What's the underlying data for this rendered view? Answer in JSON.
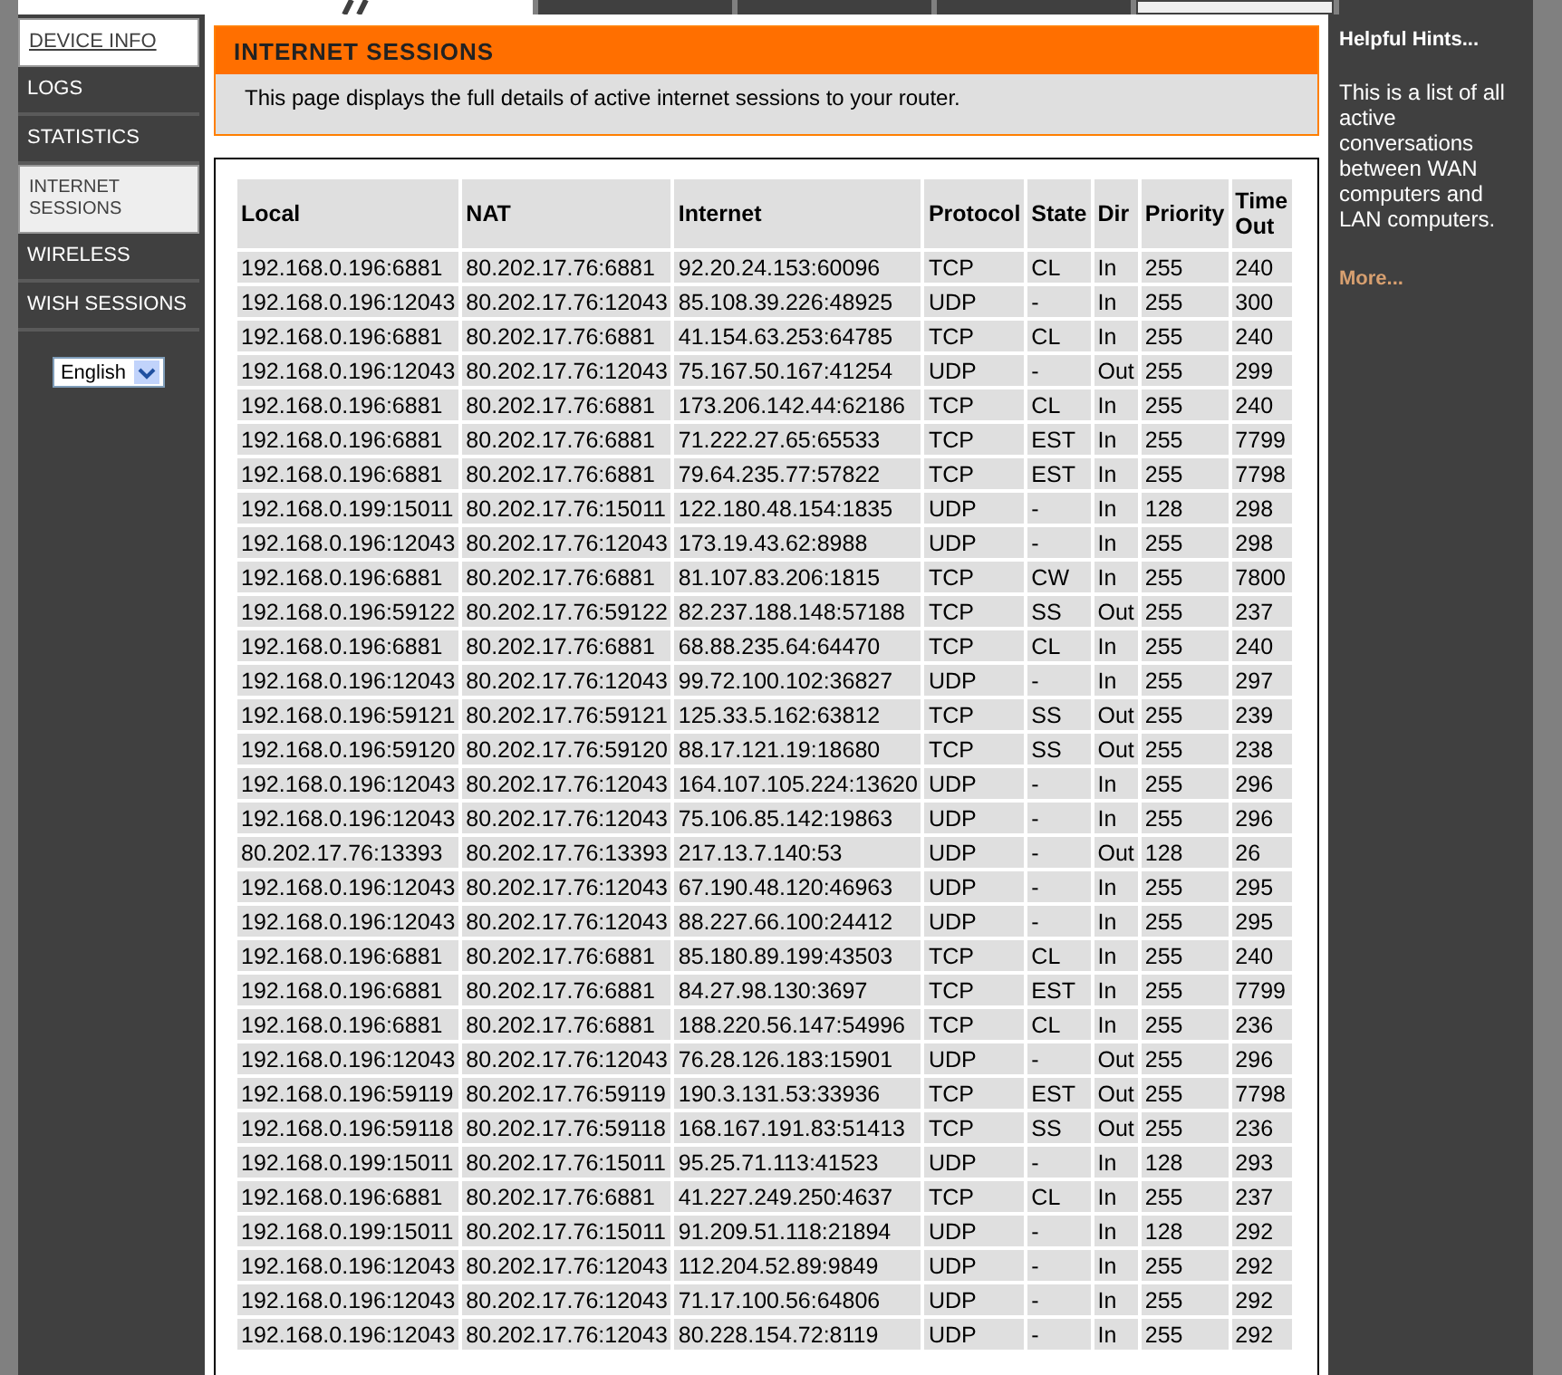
{
  "top_tabs": [
    {
      "selected": false
    },
    {
      "selected": false
    },
    {
      "selected": false
    },
    {
      "selected": true
    },
    {
      "selected": false
    }
  ],
  "sidebar": {
    "items": [
      {
        "label": "DEVICE INFO",
        "kind": "header",
        "selected": false
      },
      {
        "label": "LOGS",
        "kind": "item",
        "selected": false
      },
      {
        "label": "STATISTICS",
        "kind": "item",
        "selected": false
      },
      {
        "label": "INTERNET SESSIONS",
        "kind": "item",
        "selected": true
      },
      {
        "label": "WIRELESS",
        "kind": "item",
        "selected": false
      },
      {
        "label": "WISH SESSIONS",
        "kind": "item",
        "selected": false
      }
    ],
    "language": "English"
  },
  "section": {
    "title": "INTERNET SESSIONS",
    "description": "This page displays the full details of active internet sessions to your router."
  },
  "table": {
    "columns": [
      "Local",
      "NAT",
      "Internet",
      "Protocol",
      "State",
      "Dir",
      "Priority",
      "Time Out"
    ],
    "rows": [
      [
        "192.168.0.196:6881",
        "80.202.17.76:6881",
        "92.20.24.153:60096",
        "TCP",
        "CL",
        "In",
        "255",
        "240"
      ],
      [
        "192.168.0.196:12043",
        "80.202.17.76:12043",
        "85.108.39.226:48925",
        "UDP",
        "-",
        "In",
        "255",
        "300"
      ],
      [
        "192.168.0.196:6881",
        "80.202.17.76:6881",
        "41.154.63.253:64785",
        "TCP",
        "CL",
        "In",
        "255",
        "240"
      ],
      [
        "192.168.0.196:12043",
        "80.202.17.76:12043",
        "75.167.50.167:41254",
        "UDP",
        "-",
        "Out",
        "255",
        "299"
      ],
      [
        "192.168.0.196:6881",
        "80.202.17.76:6881",
        "173.206.142.44:62186",
        "TCP",
        "CL",
        "In",
        "255",
        "240"
      ],
      [
        "192.168.0.196:6881",
        "80.202.17.76:6881",
        "71.222.27.65:65533",
        "TCP",
        "EST",
        "In",
        "255",
        "7799"
      ],
      [
        "192.168.0.196:6881",
        "80.202.17.76:6881",
        "79.64.235.77:57822",
        "TCP",
        "EST",
        "In",
        "255",
        "7798"
      ],
      [
        "192.168.0.199:15011",
        "80.202.17.76:15011",
        "122.180.48.154:1835",
        "UDP",
        "-",
        "In",
        "128",
        "298"
      ],
      [
        "192.168.0.196:12043",
        "80.202.17.76:12043",
        "173.19.43.62:8988",
        "UDP",
        "-",
        "In",
        "255",
        "298"
      ],
      [
        "192.168.0.196:6881",
        "80.202.17.76:6881",
        "81.107.83.206:1815",
        "TCP",
        "CW",
        "In",
        "255",
        "7800"
      ],
      [
        "192.168.0.196:59122",
        "80.202.17.76:59122",
        "82.237.188.148:57188",
        "TCP",
        "SS",
        "Out",
        "255",
        "237"
      ],
      [
        "192.168.0.196:6881",
        "80.202.17.76:6881",
        "68.88.235.64:64470",
        "TCP",
        "CL",
        "In",
        "255",
        "240"
      ],
      [
        "192.168.0.196:12043",
        "80.202.17.76:12043",
        "99.72.100.102:36827",
        "UDP",
        "-",
        "In",
        "255",
        "297"
      ],
      [
        "192.168.0.196:59121",
        "80.202.17.76:59121",
        "125.33.5.162:63812",
        "TCP",
        "SS",
        "Out",
        "255",
        "239"
      ],
      [
        "192.168.0.196:59120",
        "80.202.17.76:59120",
        "88.17.121.19:18680",
        "TCP",
        "SS",
        "Out",
        "255",
        "238"
      ],
      [
        "192.168.0.196:12043",
        "80.202.17.76:12043",
        "164.107.105.224:13620",
        "UDP",
        "-",
        "In",
        "255",
        "296"
      ],
      [
        "192.168.0.196:12043",
        "80.202.17.76:12043",
        "75.106.85.142:19863",
        "UDP",
        "-",
        "In",
        "255",
        "296"
      ],
      [
        "80.202.17.76:13393",
        "80.202.17.76:13393",
        "217.13.7.140:53",
        "UDP",
        "-",
        "Out",
        "128",
        "26"
      ],
      [
        "192.168.0.196:12043",
        "80.202.17.76:12043",
        "67.190.48.120:46963",
        "UDP",
        "-",
        "In",
        "255",
        "295"
      ],
      [
        "192.168.0.196:12043",
        "80.202.17.76:12043",
        "88.227.66.100:24412",
        "UDP",
        "-",
        "In",
        "255",
        "295"
      ],
      [
        "192.168.0.196:6881",
        "80.202.17.76:6881",
        "85.180.89.199:43503",
        "TCP",
        "CL",
        "In",
        "255",
        "240"
      ],
      [
        "192.168.0.196:6881",
        "80.202.17.76:6881",
        "84.27.98.130:3697",
        "TCP",
        "EST",
        "In",
        "255",
        "7799"
      ],
      [
        "192.168.0.196:6881",
        "80.202.17.76:6881",
        "188.220.56.147:54996",
        "TCP",
        "CL",
        "In",
        "255",
        "236"
      ],
      [
        "192.168.0.196:12043",
        "80.202.17.76:12043",
        "76.28.126.183:15901",
        "UDP",
        "-",
        "Out",
        "255",
        "296"
      ],
      [
        "192.168.0.196:59119",
        "80.202.17.76:59119",
        "190.3.131.53:33936",
        "TCP",
        "EST",
        "Out",
        "255",
        "7798"
      ],
      [
        "192.168.0.196:59118",
        "80.202.17.76:59118",
        "168.167.191.83:51413",
        "TCP",
        "SS",
        "Out",
        "255",
        "236"
      ],
      [
        "192.168.0.199:15011",
        "80.202.17.76:15011",
        "95.25.71.113:41523",
        "UDP",
        "-",
        "In",
        "128",
        "293"
      ],
      [
        "192.168.0.196:6881",
        "80.202.17.76:6881",
        "41.227.249.250:4637",
        "TCP",
        "CL",
        "In",
        "255",
        "237"
      ],
      [
        "192.168.0.199:15011",
        "80.202.17.76:15011",
        "91.209.51.118:21894",
        "UDP",
        "-",
        "In",
        "128",
        "292"
      ],
      [
        "192.168.0.196:12043",
        "80.202.17.76:12043",
        "112.204.52.89:9849",
        "UDP",
        "-",
        "In",
        "255",
        "292"
      ],
      [
        "192.168.0.196:12043",
        "80.202.17.76:12043",
        "71.17.100.56:64806",
        "UDP",
        "-",
        "In",
        "255",
        "292"
      ],
      [
        "192.168.0.196:12043",
        "80.202.17.76:12043",
        "80.228.154.72:8119",
        "UDP",
        "-",
        "In",
        "255",
        "292"
      ]
    ]
  },
  "hints": {
    "title": "Helpful Hints...",
    "text": "This is a list of all active conversations between WAN computers and LAN computers.",
    "more": "More..."
  }
}
